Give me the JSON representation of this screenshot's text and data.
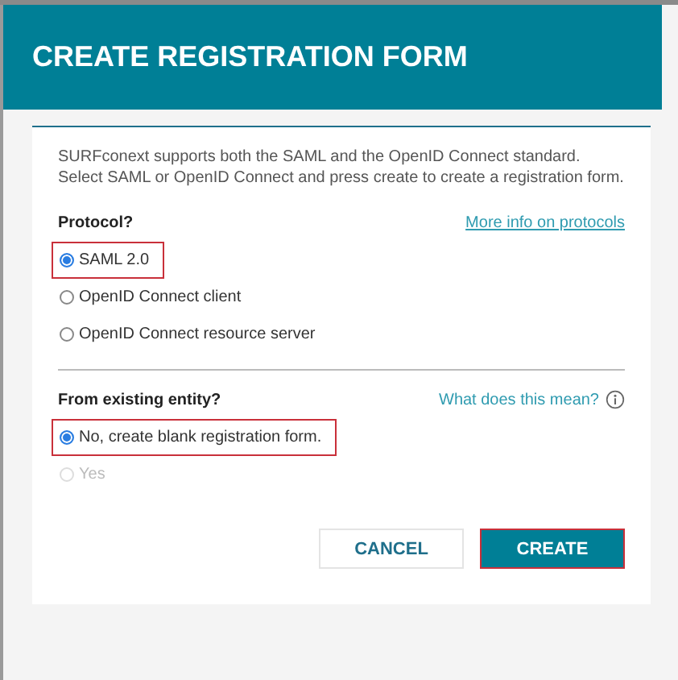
{
  "dialog": {
    "title": "CREATE REGISTRATION FORM",
    "intro": "SURFconext supports both the SAML and the OpenID Connect standard. Select SAML or OpenID Connect and press create to create a registration form.",
    "sections": [
      {
        "label": "Protocol?",
        "link": {
          "kind": "underlined",
          "text": "More info on protocols"
        },
        "options": [
          {
            "label": "SAML 2.0",
            "selected": true,
            "highlighted": true,
            "disabled": false
          },
          {
            "label": "OpenID Connect client",
            "selected": false,
            "highlighted": false,
            "disabled": false
          },
          {
            "label": "OpenID Connect resource server",
            "selected": false,
            "highlighted": false,
            "disabled": false
          }
        ]
      },
      {
        "label": "From existing entity?",
        "link": {
          "kind": "help",
          "text": "What does this mean?"
        },
        "options": [
          {
            "label": "No, create blank registration form.",
            "selected": true,
            "highlighted": true,
            "disabled": false
          },
          {
            "label": "Yes",
            "selected": false,
            "highlighted": false,
            "disabled": true
          }
        ]
      }
    ],
    "buttons": [
      {
        "label": "CANCEL",
        "kind": "secondary",
        "highlighted": false
      },
      {
        "label": "CREATE",
        "kind": "primary",
        "highlighted": true
      }
    ]
  }
}
